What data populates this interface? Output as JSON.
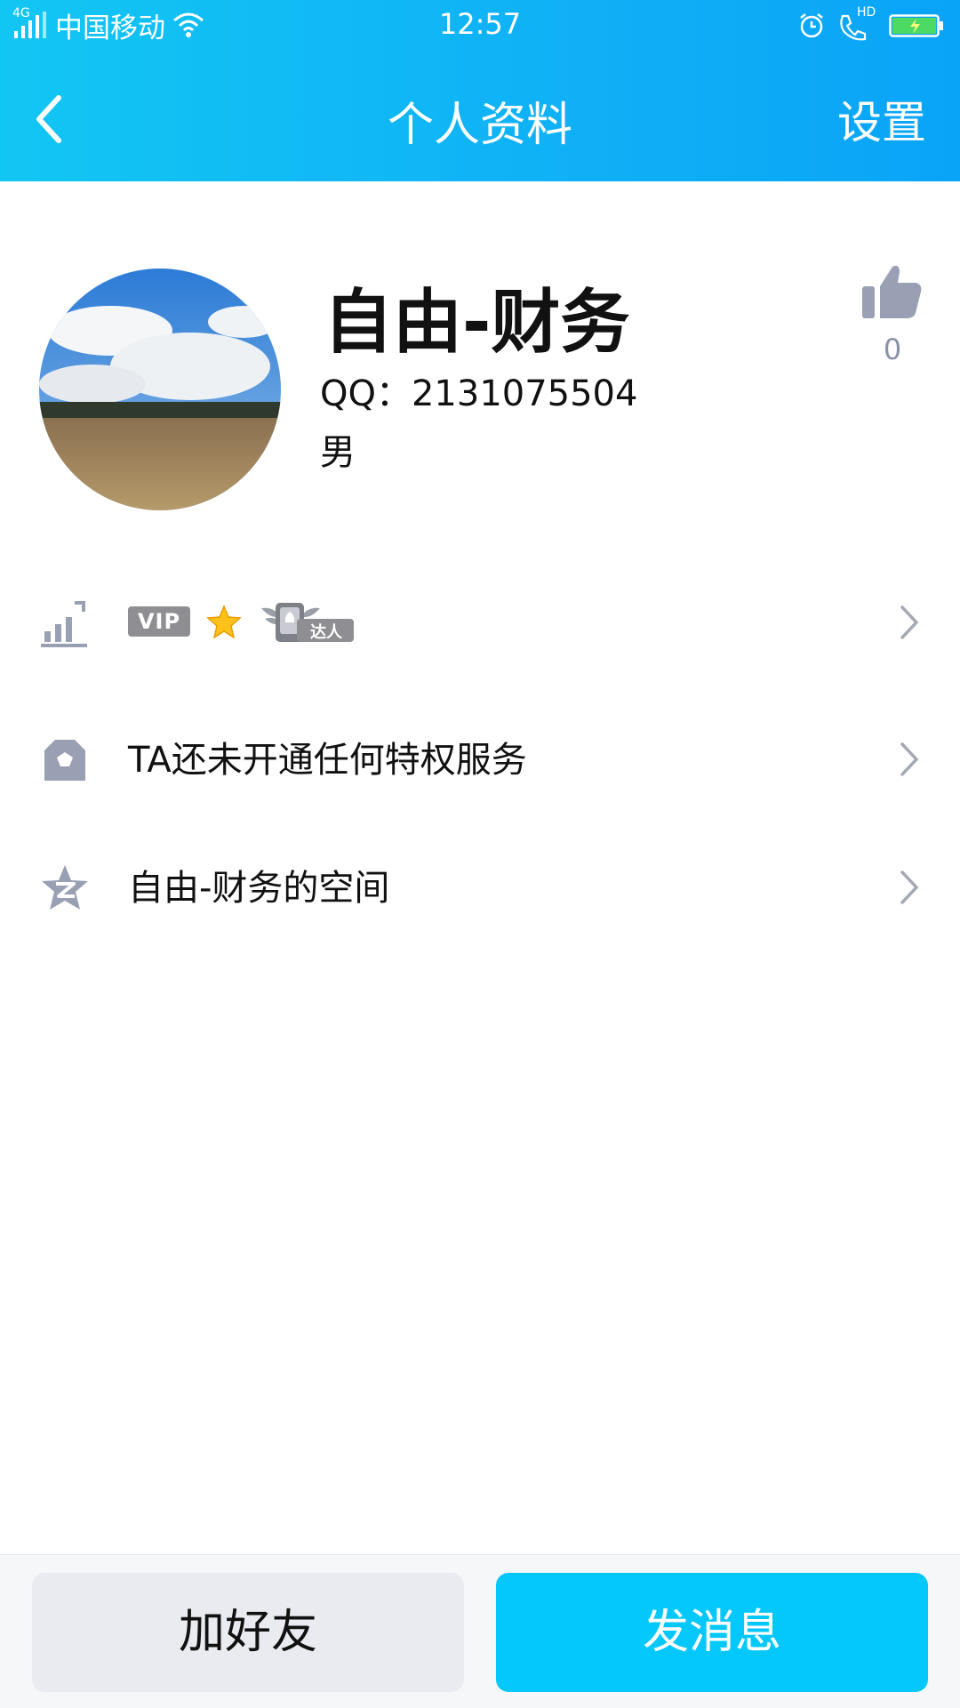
{
  "status_bar": {
    "network": "4G",
    "carrier": "中国移动",
    "time": "12:57",
    "hd_label": "HD",
    "icons": [
      "signal-icon",
      "wifi-icon",
      "alarm-icon",
      "hd-call-icon",
      "battery-charging-icon"
    ]
  },
  "navbar": {
    "title": "个人资料",
    "settings_label": "设置",
    "back_icon": "back-arrow-icon"
  },
  "profile": {
    "name": "自由-财务",
    "qq": "QQ：2131075504",
    "gender": "男",
    "like_count": "0",
    "avatar_desc": "landscape-photo"
  },
  "rows": [
    {
      "icon": "level-chart-icon",
      "badges": {
        "vip": "VIP",
        "star": "star-icon",
        "expert_label": "达人"
      }
    },
    {
      "icon": "crown-icon",
      "label": "TA还未开通任何特权服务"
    },
    {
      "icon": "qzone-star-icon",
      "label": "自由-财务的空间"
    }
  ],
  "bottom": {
    "add_friend": "加好友",
    "send_message": "发消息"
  },
  "colors": {
    "header_start": "#12c6f3",
    "header_end": "#0aa4f7",
    "primary_button": "#04c7fb",
    "secondary_button": "#e9ebf1",
    "icon_gray": "#9aa0b4"
  }
}
